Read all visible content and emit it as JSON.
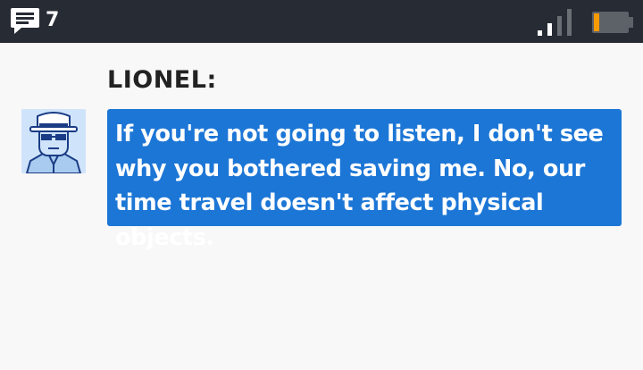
{
  "status_bar": {
    "message_count": "7",
    "message_icon": "chat-bubble-icon",
    "signal_icon": "signal-strength-icon",
    "battery_icon": "battery-low-icon",
    "battery_level_fraction": 0.1,
    "battery_color": "#f59a00"
  },
  "dialog": {
    "speaker": "LIONEL:",
    "avatar_icon": "man-with-hat-and-glasses-portrait",
    "text": "If you're not going to listen, I don't see why you bothered saving me. No, our time travel doesn't affect physical objects.",
    "box_color": "#1c76d6"
  }
}
